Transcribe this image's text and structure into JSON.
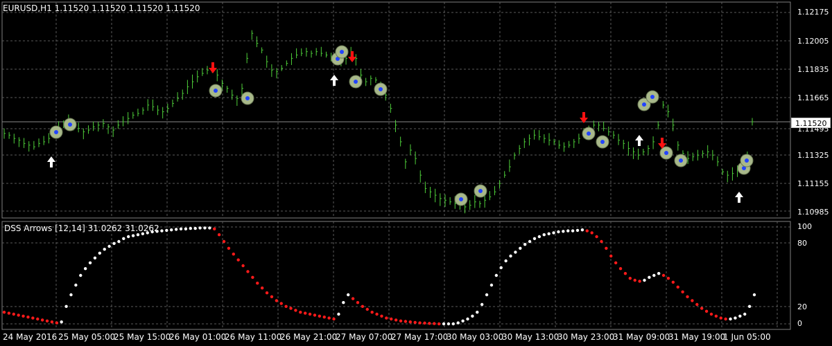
{
  "main_window": {
    "title": "EURUSD,H1  1.11520 1.11520 1.11520 1.11520",
    "current_price": "1.11520",
    "price_ticks": [
      "1.12175",
      "1.12005",
      "1.11835",
      "1.11665",
      "1.11495",
      "1.11325",
      "1.11155",
      "1.10985"
    ],
    "price_range": [
      1.10985,
      1.12175
    ]
  },
  "indicator_window": {
    "title": "DSS Arrows [12,14] 31.0262 31.0262",
    "level_ticks": [
      "100",
      "80",
      "20",
      "0"
    ],
    "level_range": [
      0,
      100
    ]
  },
  "time_axis": {
    "labels": [
      "24 May 2016",
      "25 May 05:00",
      "25 May 15:00",
      "26 May 01:00",
      "26 May 11:00",
      "26 May 21:00",
      "27 May 07:00",
      "27 May 17:00",
      "30 May 03:00",
      "30 May 13:00",
      "30 May 23:00",
      "31 May 09:00",
      "31 May 19:00",
      "1 Jun 05:00"
    ]
  },
  "colors": {
    "background": "#000000",
    "grid": "#5a5a5a",
    "bar_up": "#4fd03a",
    "dot_up": "#ffffff",
    "dot_down": "#ff1a1a",
    "arrow_up": "#ffffff",
    "arrow_down": "#ff1111",
    "circle_marker": "#a8b88a"
  },
  "chart_data": {
    "type": "line",
    "price_series": [
      1.1145,
      1.1144,
      1.1142,
      1.1141,
      1.1139,
      1.1138,
      1.1137,
      1.1139,
      1.114,
      1.1142,
      1.1145,
      1.1148,
      1.1151,
      1.1152,
      1.115,
      1.1148,
      1.1146,
      1.1147,
      1.1149,
      1.115,
      1.1151,
      1.1149,
      1.1147,
      1.115,
      1.1152,
      1.1154,
      1.1156,
      1.1157,
      1.1159,
      1.1162,
      1.1161,
      1.1159,
      1.1158,
      1.116,
      1.1163,
      1.1166,
      1.1169,
      1.1173,
      1.1176,
      1.1179,
      1.1181,
      1.1183,
      1.1184,
      1.118,
      1.1175,
      1.1172,
      1.1168,
      1.1166,
      1.1172,
      1.119,
      1.1205,
      1.1199,
      1.1195,
      1.1188,
      1.1183,
      1.1182,
      1.1184,
      1.1187,
      1.119,
      1.1192,
      1.1193,
      1.1194,
      1.1193,
      1.1194,
      1.1193,
      1.1192,
      1.119,
      1.1189,
      1.1188,
      1.119,
      1.1194,
      1.119,
      1.118,
      1.1176,
      1.1178,
      1.1177,
      1.1174,
      1.1168,
      1.116,
      1.115,
      1.114,
      1.1128,
      1.1135,
      1.113,
      1.112,
      1.1112,
      1.111,
      1.1108,
      1.1106,
      1.1105,
      1.1104,
      1.1103,
      1.1102,
      1.1101,
      1.1102,
      1.1104,
      1.1103,
      1.1105,
      1.1107,
      1.111,
      1.1115,
      1.112,
      1.1125,
      1.1132,
      1.1136,
      1.114,
      1.1142,
      1.1144,
      1.1143,
      1.1142,
      1.1141,
      1.114,
      1.1138,
      1.1137,
      1.1138,
      1.114,
      1.1142,
      1.1144,
      1.1147,
      1.115,
      1.115,
      1.1148,
      1.1146,
      1.1144,
      1.1141,
      1.1139,
      1.1136,
      1.1134,
      1.1132,
      1.1134,
      1.1136,
      1.114,
      1.115,
      1.1162,
      1.1158,
      1.115,
      1.1138,
      1.1133,
      1.113,
      1.1131,
      1.1132,
      1.1133,
      1.1134,
      1.1132,
      1.1128,
      1.1122,
      1.112,
      1.1121,
      1.1123,
      1.1125,
      1.113,
      1.1152
    ],
    "dss_series": [
      12,
      11,
      10,
      9,
      8,
      7,
      6,
      5,
      4,
      3,
      2,
      1,
      2,
      18,
      30,
      40,
      50,
      57,
      63,
      68,
      73,
      77,
      80,
      83,
      85,
      88,
      90,
      91,
      92,
      93,
      94,
      95,
      95.5,
      96,
      96.5,
      97,
      97.5,
      98,
      98,
      98.5,
      98.5,
      99,
      99,
      99,
      98,
      92,
      85,
      78,
      72,
      66,
      60,
      54,
      48,
      42,
      37,
      32,
      28,
      24,
      21,
      18,
      16,
      14,
      12,
      11,
      10,
      9,
      8,
      7,
      6,
      5,
      10,
      22,
      30,
      26,
      22,
      18,
      15,
      12,
      10,
      8,
      6,
      5,
      4,
      3,
      2.5,
      2,
      1.5,
      1,
      0.8,
      0.5,
      0.3,
      0,
      0,
      0,
      0,
      1,
      3,
      5,
      8,
      12,
      20,
      30,
      40,
      50,
      58,
      65,
      70,
      74,
      78,
      82,
      85,
      88,
      90,
      92,
      93,
      94,
      95,
      95.5,
      96,
      96,
      96.5,
      97,
      96,
      94,
      90,
      85,
      78,
      70,
      63,
      57,
      52,
      47,
      45,
      44,
      45,
      48,
      50,
      52,
      50,
      47,
      43,
      38,
      33,
      28,
      24,
      20,
      16,
      13,
      10,
      8,
      6,
      5,
      5,
      6,
      8,
      10,
      18,
      30
    ]
  }
}
